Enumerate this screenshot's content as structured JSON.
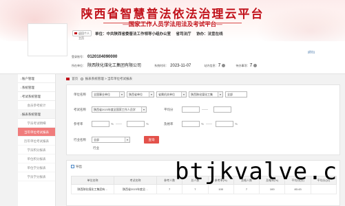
{
  "header": {
    "title": "陕西省智慧普法依法治理云平台",
    "subtitle": "—国家工作人员学法用法及考试平台—",
    "unit_pill": "返回个人主页",
    "unit_label": "单位：中共陕西省委普法工作领导小组办公室",
    "host_label": "省司法厅",
    "co_label": "协办：法宣在线",
    "exit": "[退出]"
  },
  "infobar": {
    "account_label": "登录账号：",
    "account_value": "0120104090000",
    "unit_label": "所在单位：",
    "unit_value": "陕西陕化煤化工集团有限公司",
    "time_label": "系统时间：",
    "time_value": "2023-11-07",
    "msg_label": "站内信息：",
    "msg_value": "7",
    "todo_label": "待办事项：",
    "todo_value": "7"
  },
  "sidebar": {
    "items": [
      {
        "label": "账户管理",
        "type": "parent"
      },
      {
        "label": "系统管理",
        "type": "parent"
      },
      {
        "label": "考试系统管理",
        "type": "parent"
      },
      {
        "label": "会员参考统计",
        "type": "sub"
      },
      {
        "label": "报表系统管理",
        "type": "parent-open"
      },
      {
        "label": "学员考试明细",
        "type": "sub"
      },
      {
        "label": "当年单位考试报表",
        "type": "sub-active"
      },
      {
        "label": "历年单位考试报表",
        "type": "sub"
      },
      {
        "label": "学员积分报表",
        "type": "sub"
      },
      {
        "label": "单位积分报表",
        "type": "sub"
      },
      {
        "label": "单位学分报表",
        "type": "sub"
      },
      {
        "label": "学员学分报表",
        "type": "sub"
      }
    ]
  },
  "breadcrumb": {
    "home": "首页",
    "sep": ">",
    "mid": "报表系统管理",
    "current": "当年单位考试报表"
  },
  "filters": {
    "unit_label": "单位名称",
    "unit_sel1": "全国事业单位",
    "unit_sel2": "陕西省单位",
    "unit_sel3": "省属机关单位",
    "unit_sel4": "陕西陕化煤化工集",
    "unit_sel5": "全部",
    "exam_label": "考试名称",
    "exam_value": "陕西省2023年度全国家工作人员学",
    "avg_label": "平均分",
    "ref_label": "参考率",
    "pass_label": "及格率",
    "pct": "%",
    "dash": "——",
    "industry_label": "行业名称",
    "industry_value": "全部",
    "industry_sub": "行业",
    "query_button": "查询"
  },
  "results": {
    "export_label": "导出",
    "columns": [
      "单位名称",
      "考试名称",
      "参考人数",
      "总人数",
      "参考率(%)",
      "及格人数",
      "及格率(%)",
      "平均分(分)",
      "平均分(分)"
    ],
    "rows": [
      [
        "陕西陕化煤化工集团有…",
        "陕西省2023年度全…",
        "7",
        "7",
        "100",
        "7",
        "100",
        "83.43",
        ""
      ]
    ]
  },
  "watermark": "btjkvalve.c"
}
